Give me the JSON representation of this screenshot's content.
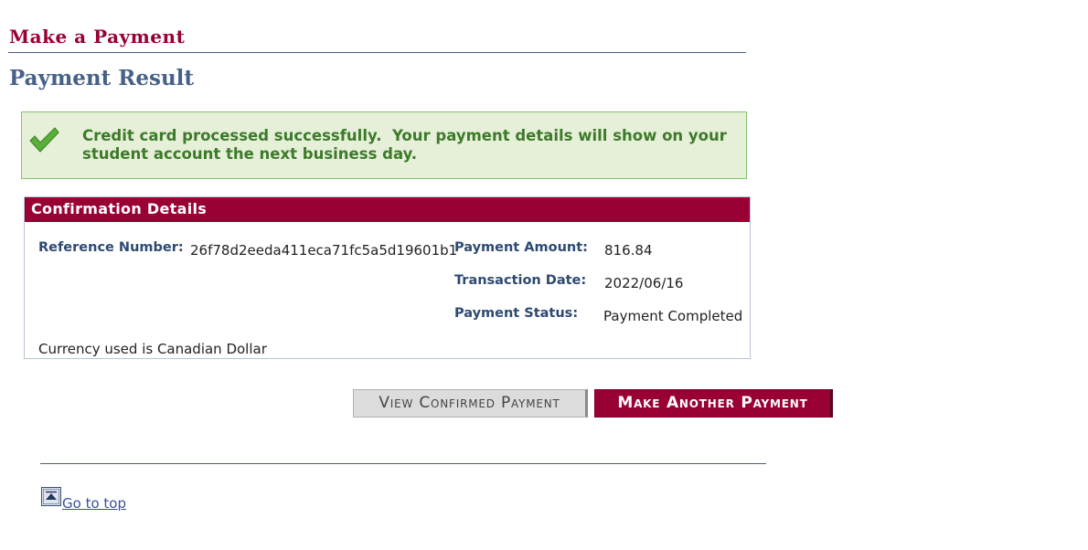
{
  "header": {
    "title": "Make a Payment",
    "section_title": "Payment Result"
  },
  "success_message": {
    "icon": "checkmark-icon",
    "text": "Credit card processed successfully.  Your payment details will show on your\nstudent account the next business day."
  },
  "confirmation": {
    "header": "Confirmation Details",
    "reference_label": "Reference Number:",
    "reference_value": "26f78d2eeda411eca71fc5a5d19601b1",
    "amount_label": "Payment Amount:",
    "amount_value": "816.84",
    "date_label": "Transaction Date:",
    "date_value": "2022/06/16",
    "status_label": "Payment Status:",
    "status_value": "Payment Completed",
    "currency_note": "Currency used is Canadian Dollar"
  },
  "buttons": {
    "view_confirmed": "View Confirmed Payment",
    "make_another": "Make Another Payment"
  },
  "footer": {
    "go_to_top": "Go to top",
    "icon": "go-to-top-icon"
  },
  "colors": {
    "brand": "#990033",
    "heading": "#466187",
    "success_bg": "#e6f0d9",
    "success_text": "#3d7a2a"
  }
}
